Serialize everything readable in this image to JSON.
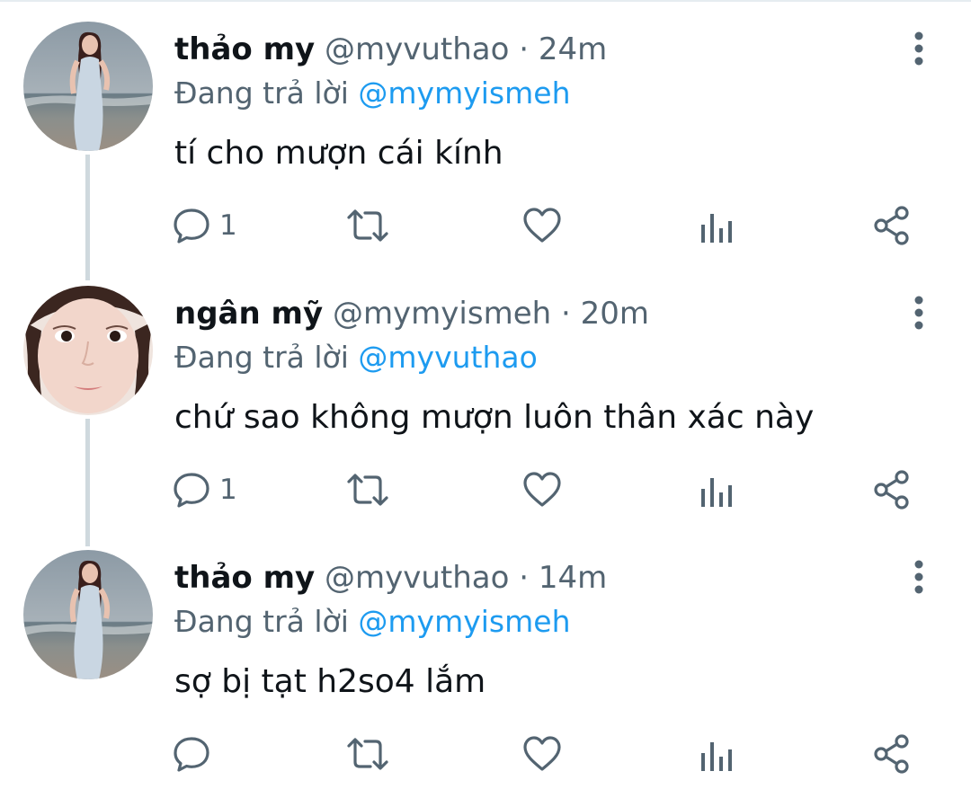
{
  "tweets": [
    {
      "display_name": "thảo my",
      "handle": "@myvuthao",
      "separator": "·",
      "time": "24m",
      "reply_prefix": "Đang trả lời",
      "reply_to": "@mymyismeh",
      "text": "tí cho mượn cái kính",
      "reply_count": "1",
      "avatar": "beach-portrait"
    },
    {
      "display_name": "ngân mỹ",
      "handle": "@mymyismeh",
      "separator": "·",
      "time": "20m",
      "reply_prefix": "Đang trả lời",
      "reply_to": "@myvuthao",
      "text": "chứ sao không mượn luôn thân xác này",
      "reply_count": "1",
      "avatar": "face-closeup"
    },
    {
      "display_name": "thảo my",
      "handle": "@myvuthao",
      "separator": "·",
      "time": "14m",
      "reply_prefix": "Đang trả lời",
      "reply_to": "@mymyismeh",
      "text": "sợ bị tạt h2so4 lắm",
      "reply_count": "",
      "avatar": "beach-portrait"
    }
  ],
  "icons": {
    "reply": "reply-icon",
    "retweet": "retweet-icon",
    "like": "like-icon",
    "stats": "stats-icon",
    "share": "share-icon",
    "more": "more-vertical-icon"
  },
  "colors": {
    "text": "#0f1419",
    "secondary": "#536471",
    "link": "#1d9bf0",
    "thread_line": "#cfd9de"
  }
}
